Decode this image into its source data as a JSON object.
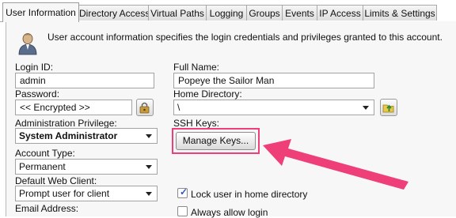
{
  "tabs": [
    {
      "label": "User Information",
      "active": true
    },
    {
      "label": "Directory Access"
    },
    {
      "label": "Virtual Paths"
    },
    {
      "label": "Logging"
    },
    {
      "label": "Groups"
    },
    {
      "label": "Events"
    },
    {
      "label": "IP Access"
    },
    {
      "label": "Limits & Settings"
    }
  ],
  "intro": "User account information specifies the login credentials and privileges granted to this account.",
  "fields": {
    "login_id": {
      "label": "Login ID:",
      "value": "admin"
    },
    "password": {
      "label": "Password:",
      "value": "<< Encrypted >>"
    },
    "admin_privilege": {
      "label": "Administration Privilege:",
      "value": "System Administrator"
    },
    "account_type": {
      "label": "Account Type:",
      "value": "Permanent"
    },
    "default_web_client": {
      "label": "Default Web Client:",
      "value": "Prompt user for client"
    },
    "email": {
      "label": "Email Address:"
    },
    "full_name": {
      "label": "Full Name:",
      "value": "Popeye the Sailor Man"
    },
    "home_directory": {
      "label": "Home Directory:",
      "value": "\\"
    },
    "ssh_keys": {
      "label": "SSH Keys:",
      "button": "Manage Keys..."
    }
  },
  "checkboxes": [
    {
      "label": "Lock user in home directory",
      "checked": true
    },
    {
      "label": "Always allow login",
      "checked": false
    }
  ],
  "icons": {
    "user": "user-account-icon",
    "password_generator": "key-lock-icon",
    "browse_folder": "folder-up-arrow-icon",
    "annotation": "pink-arrow-annotation"
  },
  "colors": {
    "highlight": "#ee3f78",
    "checkbox_check": "#2b56c9"
  }
}
